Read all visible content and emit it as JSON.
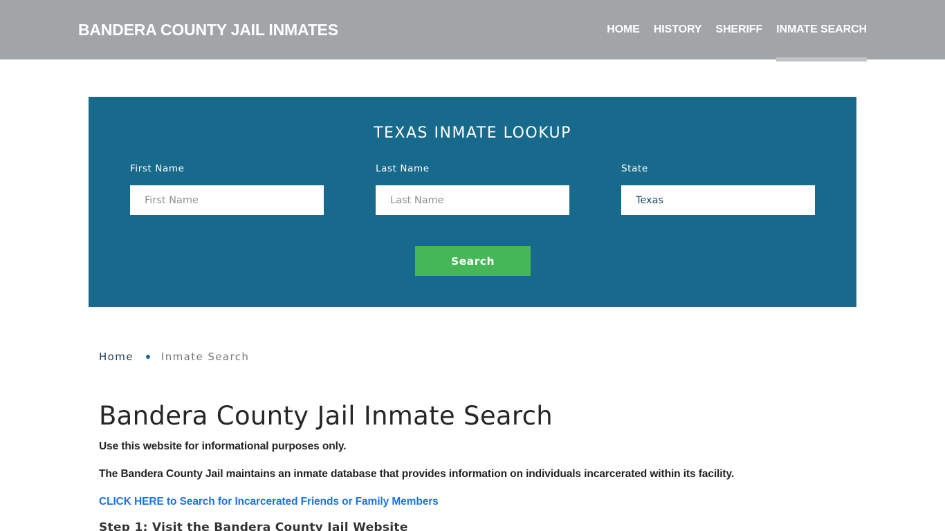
{
  "header": {
    "brand": "BANDERA COUNTY JAIL INMATES",
    "nav": [
      {
        "label": "HOME",
        "active": false
      },
      {
        "label": "HISTORY",
        "active": false
      },
      {
        "label": "SHERIFF",
        "active": false
      },
      {
        "label": "INMATE SEARCH",
        "active": true
      }
    ]
  },
  "lookup": {
    "title": "TEXAS INMATE LOOKUP",
    "fields": {
      "first_name": {
        "label": "First Name",
        "placeholder": "First Name",
        "value": ""
      },
      "last_name": {
        "label": "Last Name",
        "placeholder": "Last Name",
        "value": ""
      },
      "state": {
        "label": "State",
        "placeholder": "",
        "value": "Texas"
      }
    },
    "search_label": "Search"
  },
  "breadcrumb": {
    "home": "Home",
    "current": "Inmate Search"
  },
  "content": {
    "title": "Bandera County Jail Inmate Search",
    "paragraph1": "Use this website for informational purposes only.",
    "paragraph2": "The Bandera County Jail maintains an inmate database that provides information on individuals incarcerated within its facility.",
    "cta_link": "CLICK HERE to Search for Incarcerated Friends or Family Members",
    "step1": "Step 1: Visit the Bandera County Jail Website"
  },
  "colors": {
    "header_bg": "#a1a5a8",
    "lookup_bg": "#186a8c",
    "search_button": "#45b757",
    "link": "#1a73e8"
  }
}
